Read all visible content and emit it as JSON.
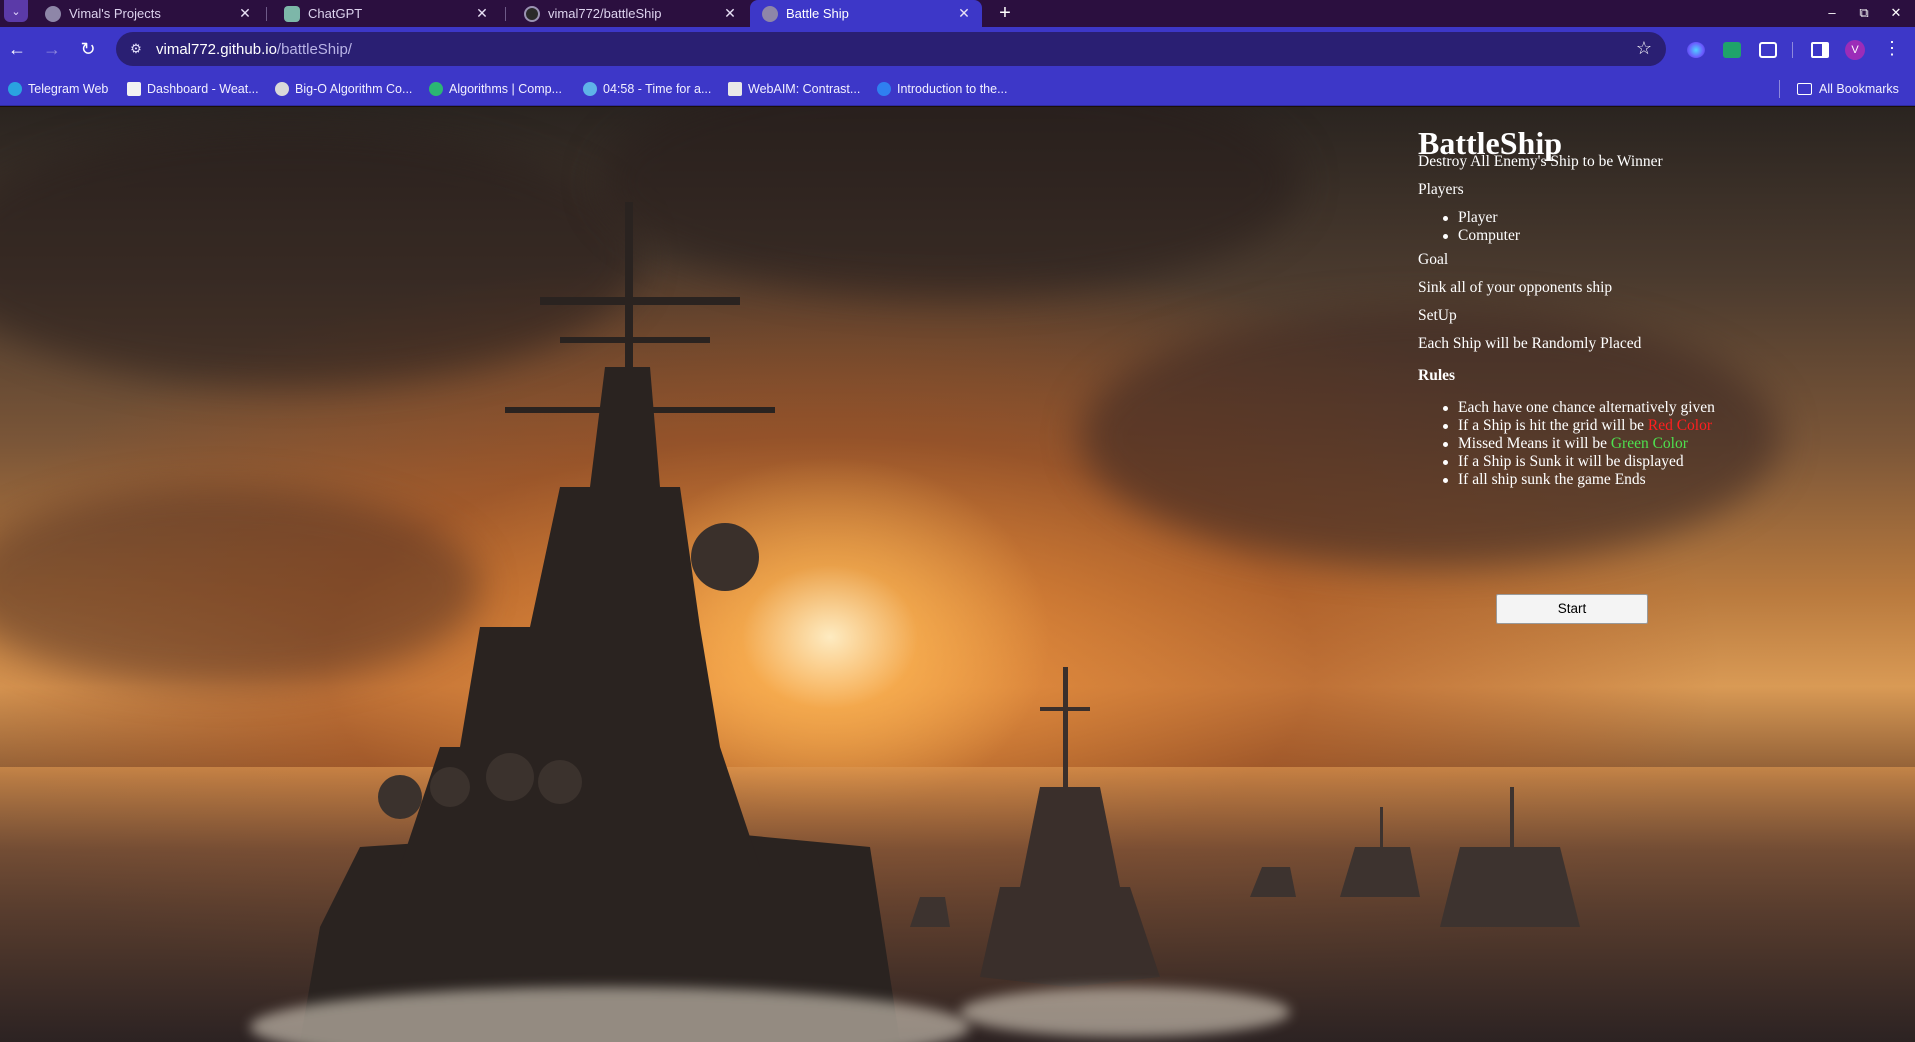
{
  "browser": {
    "tabs": [
      {
        "label": "Vimal's Projects",
        "close": "✕"
      },
      {
        "label": "ChatGPT",
        "close": "✕"
      },
      {
        "label": "vimal772/battleShip",
        "close": "✕"
      },
      {
        "label": "Battle Ship",
        "close": "✕",
        "active": true
      }
    ],
    "new_tab": "+",
    "window_controls": {
      "minimize": "–",
      "restore": "⧉",
      "close": "✕"
    },
    "url": {
      "host": "vimal772.github.io",
      "path": "/battleShip/"
    },
    "avatar_letter": "V",
    "bookmarks": [
      {
        "label": "Telegram Web",
        "icon": "telegram-icon",
        "color": "#2aa3e0"
      },
      {
        "label": "Dashboard - Weat...",
        "icon": "document-icon",
        "color": "#f2f2f2"
      },
      {
        "label": "Big-O Algorithm Co...",
        "icon": "globe-icon",
        "color": "#d9d9d9"
      },
      {
        "label": "Algorithms | Comp...",
        "icon": "shield-icon",
        "color": "#2bb673"
      },
      {
        "label": "04:58 - Time for a...",
        "icon": "check-icon",
        "color": "#5fb3e8"
      },
      {
        "label": "WebAIM: Contrast...",
        "icon": "gear-icon",
        "color": "#e8e8e8"
      },
      {
        "label": "Introduction to the...",
        "icon": "c-icon",
        "color": "#2f7ff0"
      }
    ],
    "all_bookmarks": "All Bookmarks"
  },
  "page": {
    "title": "BattleShip",
    "tagline": "Destroy All Enemy's Ship to be Winner",
    "players_heading": "Players",
    "players": [
      "Player",
      "Computer"
    ],
    "goal_heading": "Goal",
    "goal_text": "Sink all of your opponents ship",
    "setup_heading": "SetUp",
    "setup_text": "Each Ship will be Randomly Placed",
    "rules_heading": "Rules",
    "rules": {
      "r1": "Each have one chance alternatively given",
      "r2_prefix": "If a Ship is hit the grid will be ",
      "r2_color": "Red Color",
      "r3_prefix": "Missed Means it will be ",
      "r3_color": "Green Color",
      "r4": "If a Ship is Sunk it will be displayed",
      "r5": "If all ship sunk the game Ends"
    },
    "start_button": "Start",
    "colors": {
      "hit": "#ff1f1f",
      "miss": "#4ee04e"
    }
  }
}
